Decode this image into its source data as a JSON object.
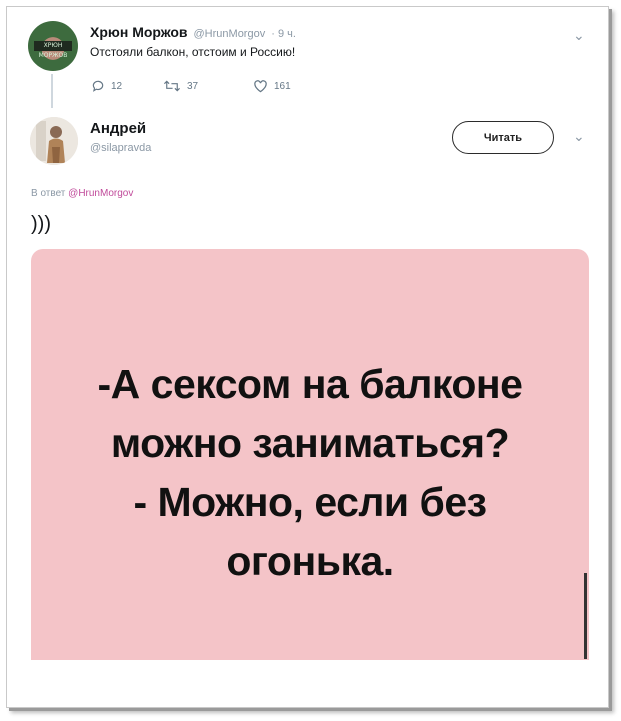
{
  "original_tweet": {
    "author_name": "Хрюн Моржов",
    "handle": "@HrunMorgov",
    "time": "· 9 ч.",
    "text": "Отстояли балкон, отстоим и Россию!",
    "replies": "12",
    "retweets": "37",
    "likes": "161"
  },
  "reply_tweet": {
    "author_name": "Андрей",
    "handle": "@silapravda",
    "follow_label": "Читать",
    "reply_to_prefix": "В ответ",
    "reply_to_handle": "@HrunMorgov",
    "text": ")))"
  },
  "media": {
    "lines": [
      "-А сексом  на балконе",
      "можно заниматься?",
      "- Можно, если без",
      "огонька."
    ]
  },
  "colors": {
    "media_bg": "#f4c4c8",
    "link": "#c04a9a",
    "muted": "#8b98a5"
  }
}
